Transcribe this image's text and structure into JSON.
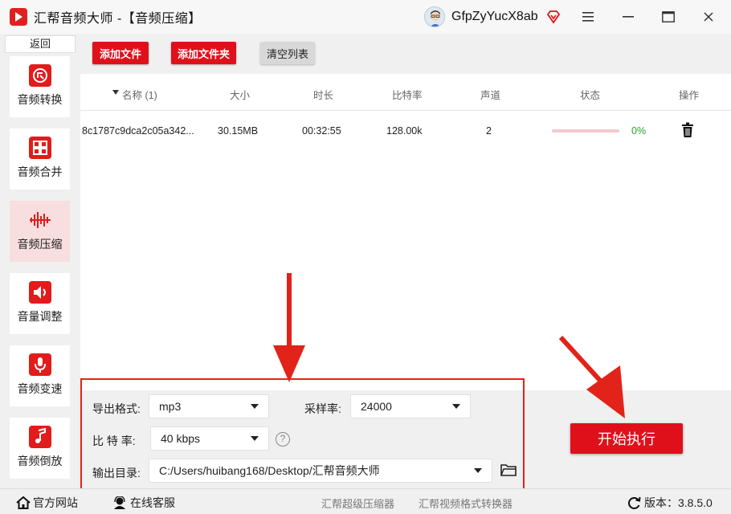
{
  "titlebar": {
    "app_title": "汇帮音频大师 -【音频压缩】",
    "username": "GfpZyYucX8ab"
  },
  "sidebar": {
    "back_label": "返回",
    "items": [
      {
        "label": "音频转换",
        "icon": "audio-convert-icon"
      },
      {
        "label": "音频合并",
        "icon": "audio-merge-icon"
      },
      {
        "label": "音频压缩",
        "icon": "audio-compress-icon",
        "active": true
      },
      {
        "label": "音量调整",
        "icon": "volume-icon"
      },
      {
        "label": "音频变速",
        "icon": "microphone-icon"
      },
      {
        "label": "音频倒放",
        "icon": "music-note-icon"
      }
    ]
  },
  "toolbar": {
    "add_file": "添加文件",
    "add_folder": "添加文件夹",
    "clear_list": "清空列表"
  },
  "table": {
    "headers": {
      "name": "名称 (1)",
      "size": "大小",
      "duration": "时长",
      "bitrate": "比特率",
      "channels": "声道",
      "status": "状态",
      "action": "操作"
    },
    "rows": [
      {
        "name": "8c1787c9dca2c05a342...",
        "size": "30.15MB",
        "duration": "00:32:55",
        "bitrate": "128.00k",
        "channels": "2",
        "progress": 0,
        "progress_text": "0%"
      }
    ]
  },
  "settings": {
    "format_label": "导出格式:",
    "format_value": "mp3",
    "samplerate_label": "采样率:",
    "samplerate_value": "24000",
    "bitrate_label": "比 特 率:",
    "bitrate_value": "40 kbps",
    "output_label": "输出目录:",
    "output_value": "C:/Users/huibang168/Desktop/汇帮音频大师",
    "help_glyph": "?"
  },
  "start_button": "开始执行",
  "statusbar": {
    "website": "官方网站",
    "support": "在线客服",
    "link1": "汇帮超级压缩器",
    "link2": "汇帮视频格式转换器",
    "version_label": "版本：",
    "version": "3.8.5.0"
  },
  "colors": {
    "accent": "#e0101b",
    "progress": "#2aa52a"
  }
}
